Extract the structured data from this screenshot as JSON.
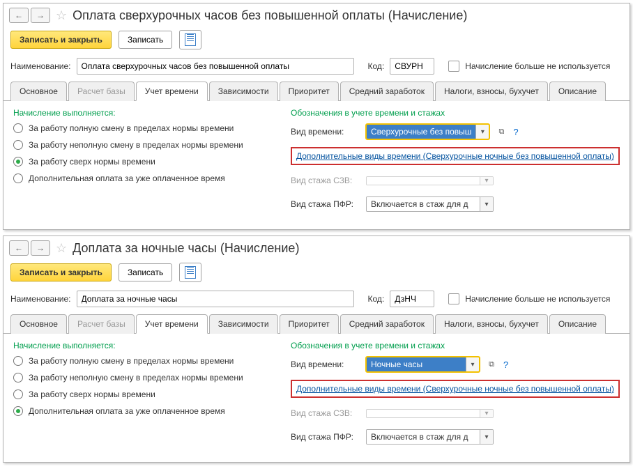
{
  "w1": {
    "title": "Оплата сверхурочных часов без повышенной оплаты (Начисление)",
    "btn_save_close": "Записать и закрыть",
    "btn_save": "Записать",
    "name_lbl": "Наименование:",
    "name_val": "Оплата сверхурочных часов без повышенной оплаты",
    "code_lbl": "Код:",
    "code_val": "СВУРН",
    "deprecated_lbl": "Начисление больше не используется",
    "tabs": [
      "Основное",
      "Расчет базы",
      "Учет времени",
      "Зависимости",
      "Приоритет",
      "Средний заработок",
      "Налоги, взносы, бухучет",
      "Описание"
    ],
    "exec_h": "Начисление выполняется:",
    "radios": [
      "За работу полную смену в пределах нормы времени",
      "За работу неполную смену в пределах нормы времени",
      "За работу сверх нормы времени",
      "Дополнительная оплата за уже оплаченное время"
    ],
    "radio_sel": 2,
    "marks_h": "Обозначения в учете времени и стажах",
    "vid_vremeni_lbl": "Вид времени:",
    "vid_vremeni_val": "Сверхурочные без повыш",
    "extra_link": "Дополнительные виды времени (Сверхурочные ночные без повышенной оплаты)",
    "vid_szv_lbl": "Вид стажа СЗВ:",
    "vid_pfr_lbl": "Вид стажа ПФР:",
    "vid_pfr_val": "Включается в стаж для д"
  },
  "w2": {
    "title": "Доплата за ночные часы (Начисление)",
    "btn_save_close": "Записать и закрыть",
    "btn_save": "Записать",
    "name_lbl": "Наименование:",
    "name_val": "Доплата за ночные часы",
    "code_lbl": "Код:",
    "code_val": "ДзНЧ",
    "deprecated_lbl": "Начисление больше не используется",
    "tabs": [
      "Основное",
      "Расчет базы",
      "Учет времени",
      "Зависимости",
      "Приоритет",
      "Средний заработок",
      "Налоги, взносы, бухучет",
      "Описание"
    ],
    "exec_h": "Начисление выполняется:",
    "radios": [
      "За работу полную смену в пределах нормы времени",
      "За работу неполную смену в пределах нормы времени",
      "За работу сверх нормы времени",
      "Дополнительная оплата за уже оплаченное время"
    ],
    "radio_sel": 3,
    "marks_h": "Обозначения в учете времени и стажах",
    "vid_vremeni_lbl": "Вид времени:",
    "vid_vremeni_val": "Ночные часы",
    "extra_link": "Дополнительные виды времени (Сверхурочные ночные без повышенной оплаты)",
    "vid_szv_lbl": "Вид стажа СЗВ:",
    "vid_pfr_lbl": "Вид стажа ПФР:",
    "vid_pfr_val": "Включается в стаж для д"
  }
}
